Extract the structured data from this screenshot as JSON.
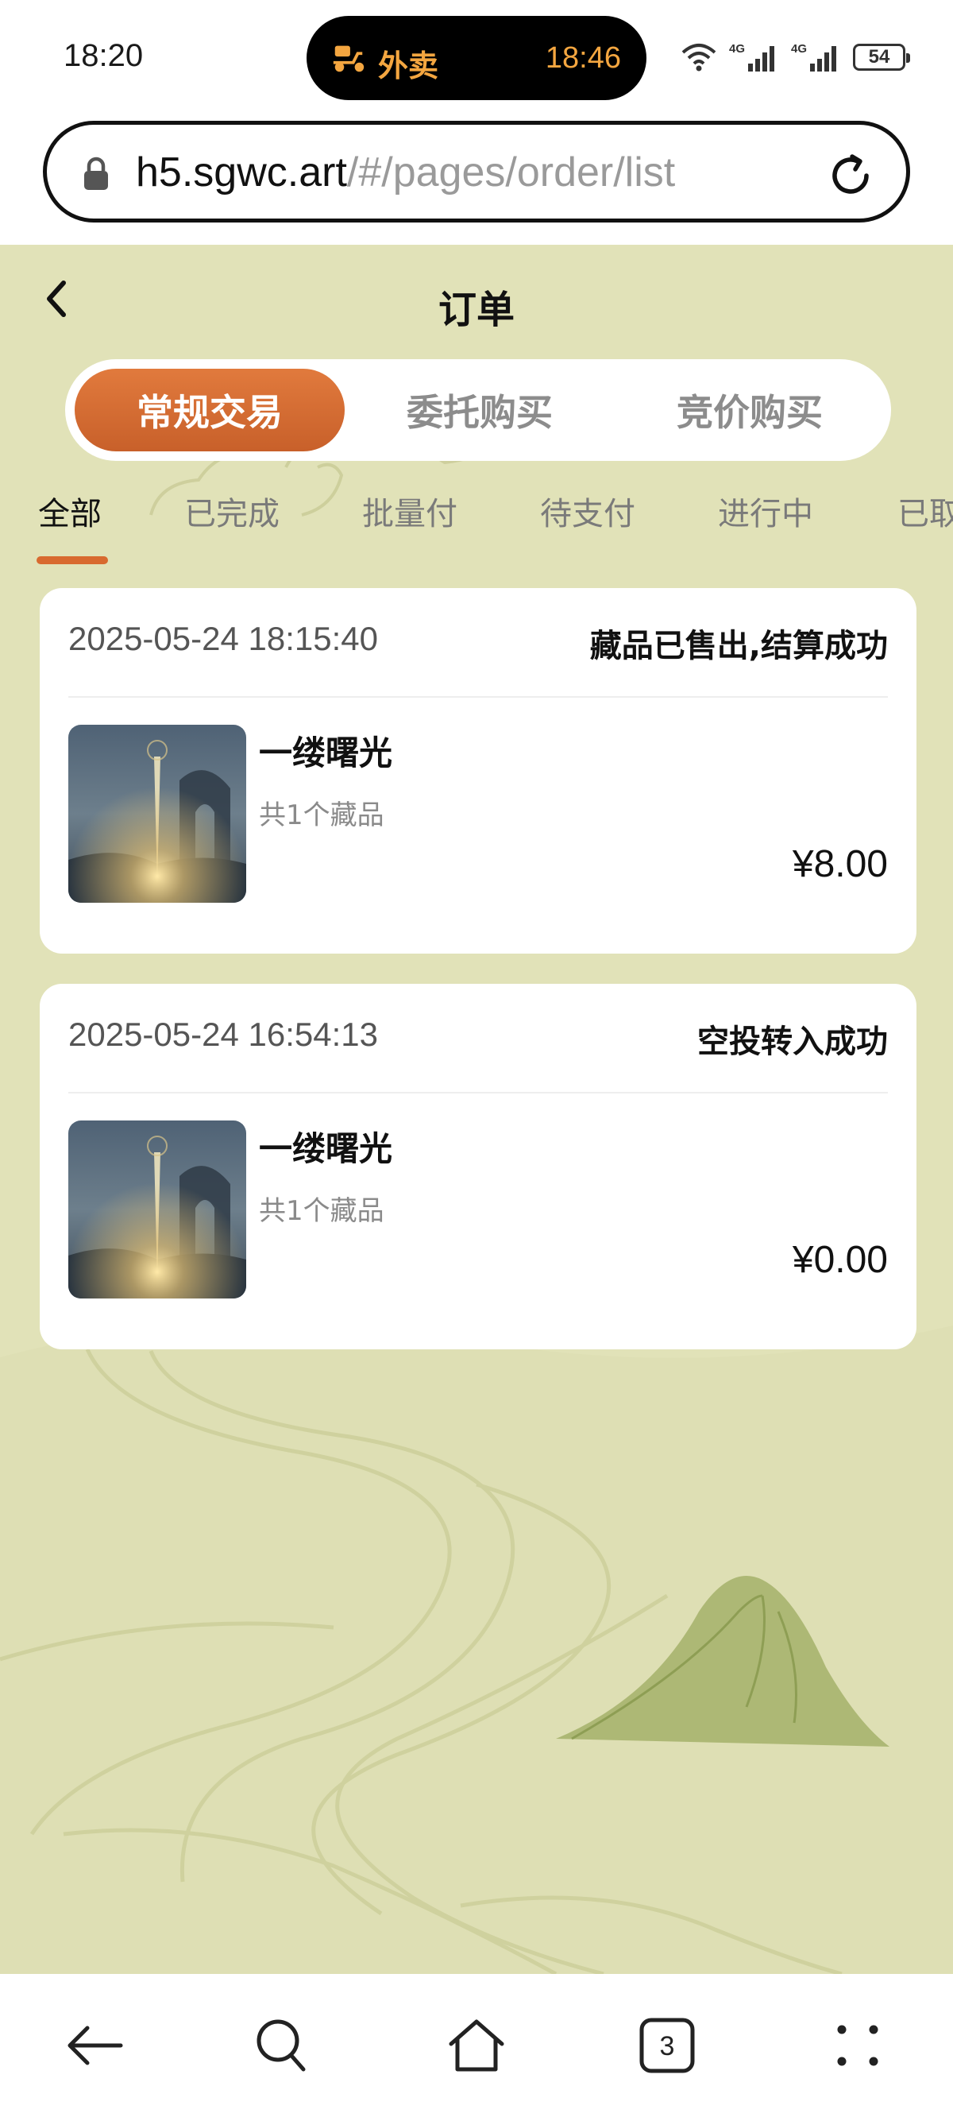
{
  "status_bar": {
    "time": "18:20",
    "island_app": "外卖",
    "island_time": "18:46",
    "battery": "54",
    "icons": [
      "wifi-icon",
      "signal-4g-icon",
      "signal-4g-icon",
      "battery-icon"
    ]
  },
  "browser": {
    "url_host": "h5.sgwc.art",
    "url_path": "/#/pages/order/list",
    "tab_count": "3"
  },
  "page": {
    "title": "订单",
    "segments": [
      "常规交易",
      "委托购买",
      "竞价购买"
    ],
    "active_segment": 0,
    "tabs": [
      "全部",
      "已完成",
      "批量付",
      "待支付",
      "进行中",
      "已取"
    ],
    "active_tab": 0
  },
  "orders": [
    {
      "date": "2025-05-24 18:15:40",
      "status": "藏品已售出,结算成功",
      "name": "一缕曙光",
      "count": "共1个藏品",
      "price": "¥8.00"
    },
    {
      "date": "2025-05-24 16:54:13",
      "status": "空投转入成功",
      "name": "一缕曙光",
      "count": "共1个藏品",
      "price": "¥0.00"
    }
  ],
  "colors": {
    "accent": "#d86a2f",
    "page_bg": "#e1e2b8",
    "island_text": "#f4a640"
  }
}
